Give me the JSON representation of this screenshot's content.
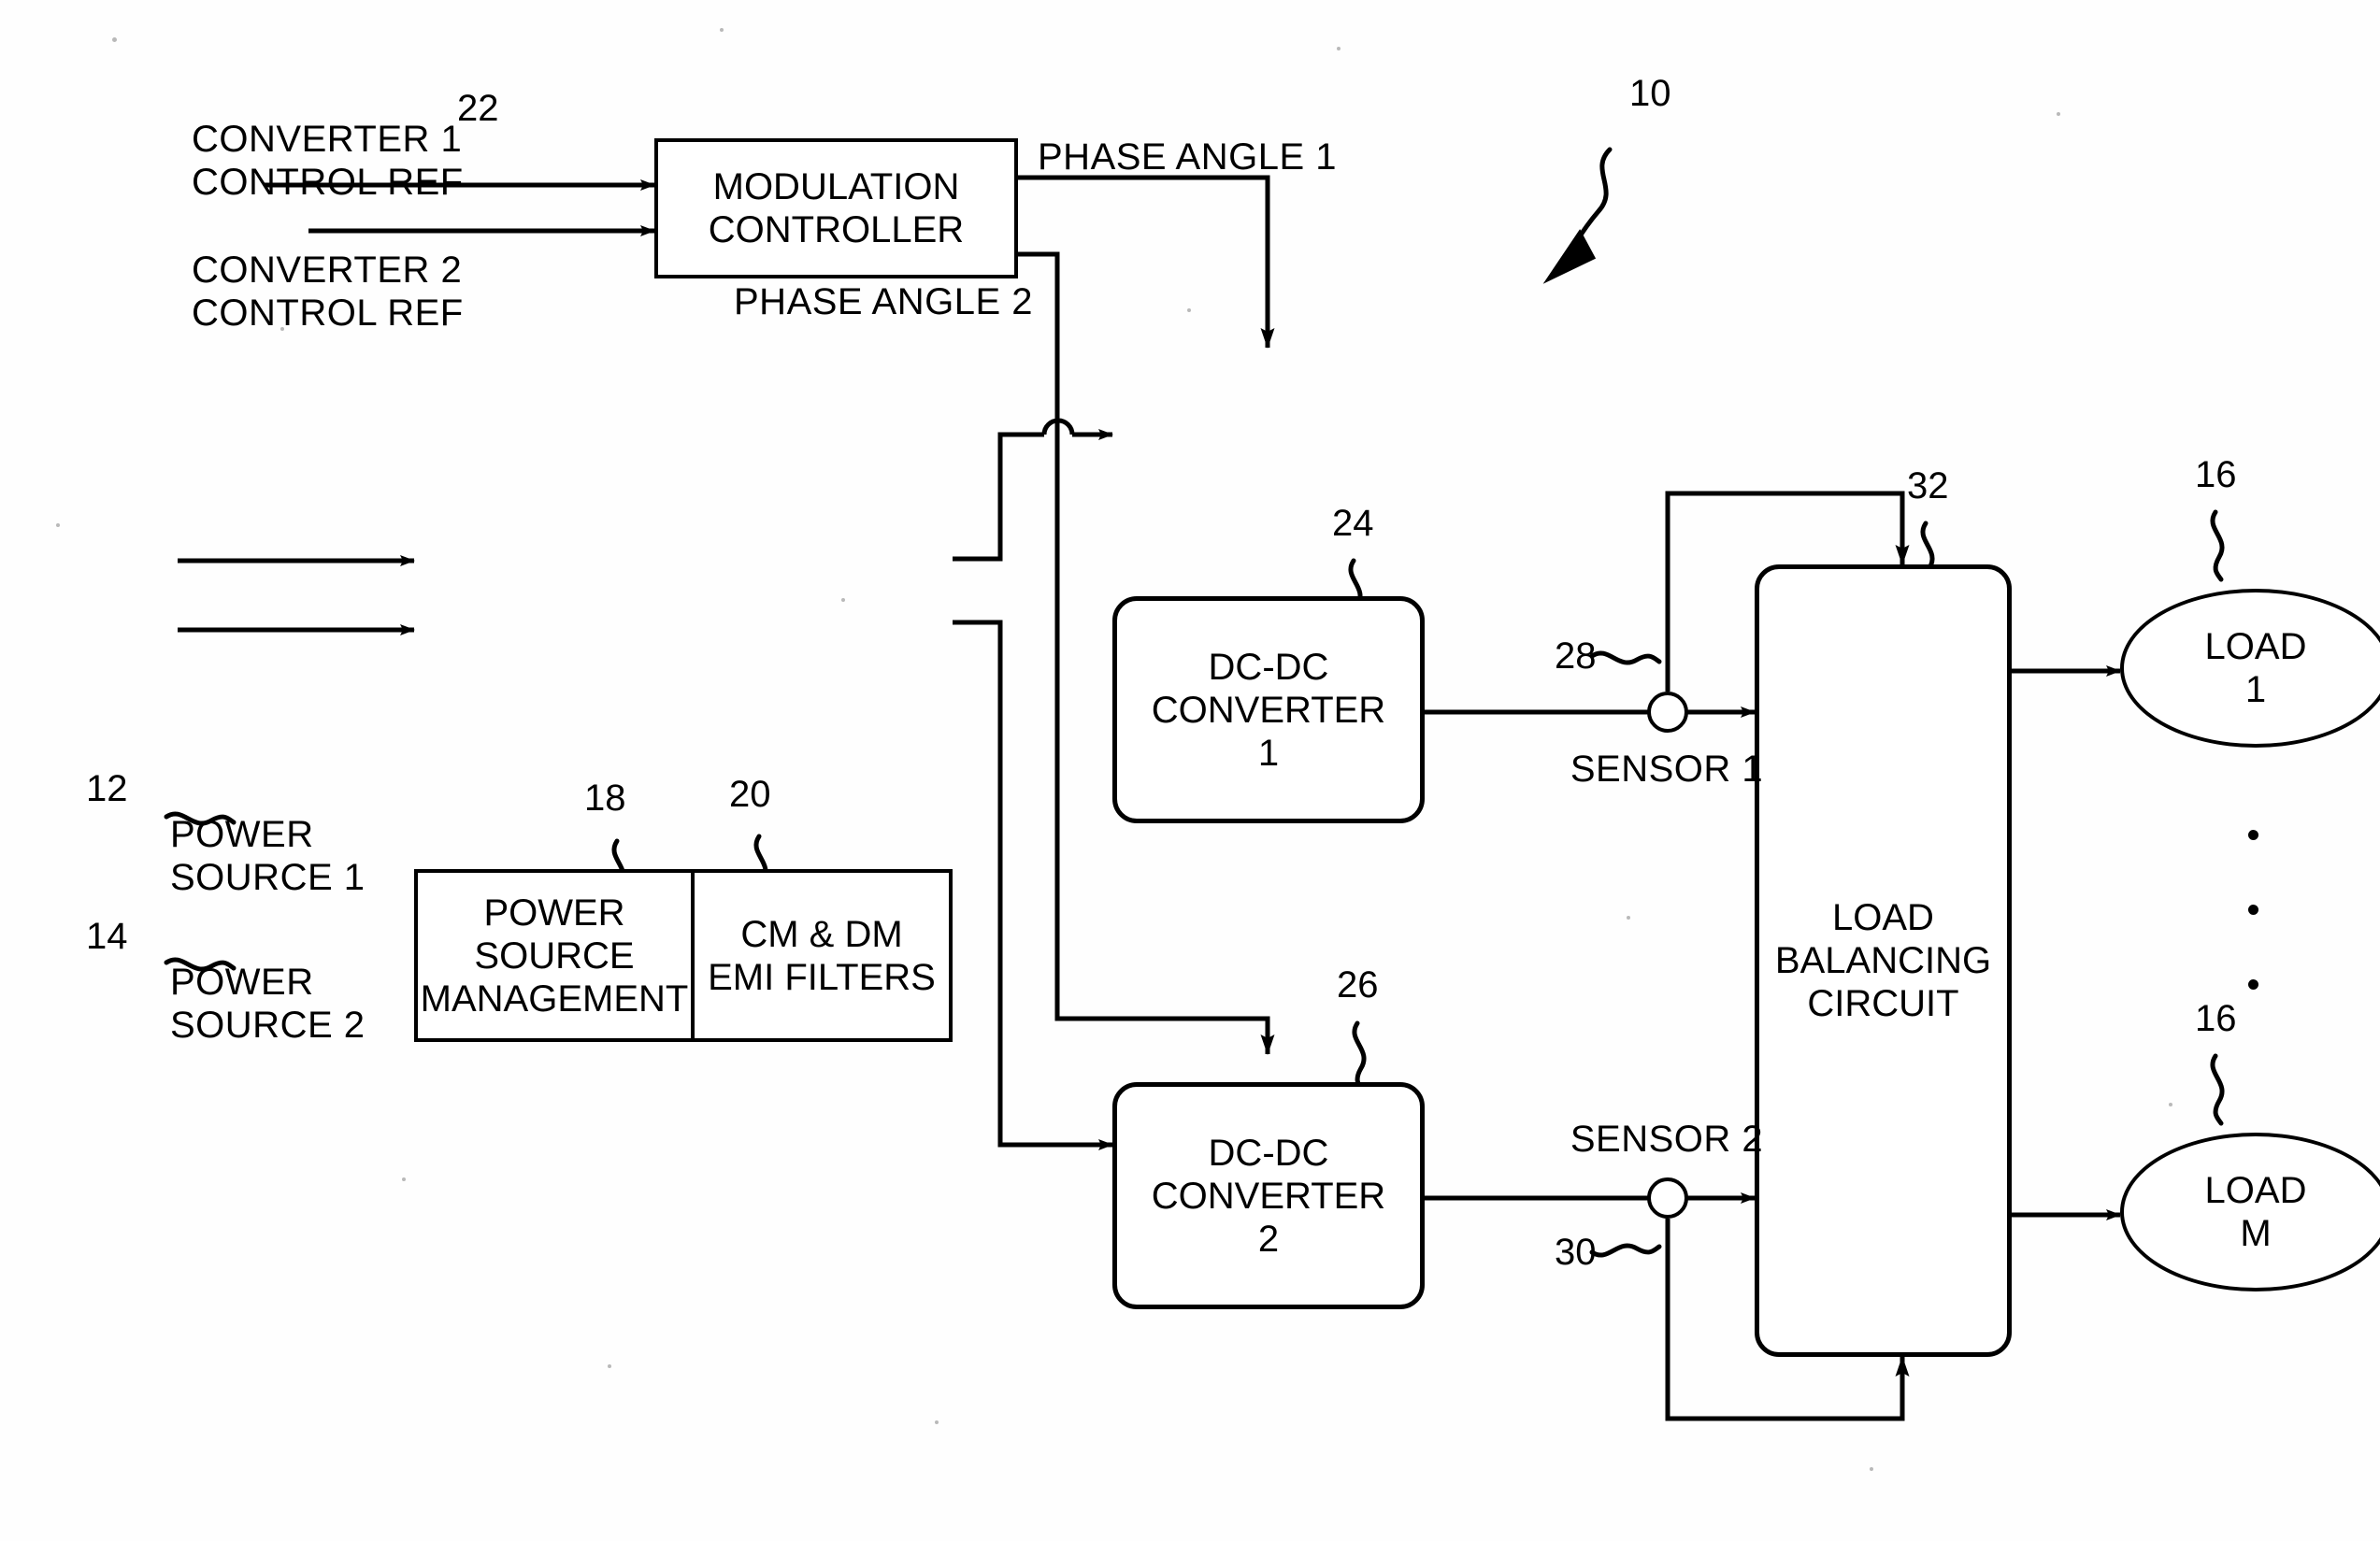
{
  "figure": {
    "type": "patent-block-diagram",
    "system_ref": "10",
    "inputs": {
      "converter1_control_ref": "CONVERTER 1\nCONTROL REF",
      "converter2_control_ref": "CONVERTER 2\nCONTROL REF",
      "power_source_1": "POWER\nSOURCE 1",
      "power_source_2": "POWER\nSOURCE 2",
      "power_source_1_ref": "12",
      "power_source_2_ref": "14"
    },
    "blocks": [
      {
        "id": "modulation_controller",
        "label": "MODULATION\nCONTROLLER",
        "ref": "22",
        "shape": "rect"
      },
      {
        "id": "power_source_management",
        "label": "POWER\nSOURCE\nMANAGEMENT",
        "ref": "18",
        "shape": "rect"
      },
      {
        "id": "emi_filters",
        "label": "CM & DM\nEMI FILTERS",
        "ref": "20",
        "shape": "rect"
      },
      {
        "id": "dc_dc_converter_1",
        "label": "DC-DC\nCONVERTER\n1",
        "ref": "24",
        "shape": "rounded-rect"
      },
      {
        "id": "dc_dc_converter_2",
        "label": "DC-DC\nCONVERTER\n2",
        "ref": "26",
        "shape": "rounded-rect"
      },
      {
        "id": "load_balancing_circuit",
        "label": "LOAD\nBALANCING\nCIRCUIT",
        "ref": "32",
        "shape": "rounded-rect"
      },
      {
        "id": "load_1",
        "label": "LOAD\n1",
        "ref": "16",
        "shape": "ellipse"
      },
      {
        "id": "load_m",
        "label": "LOAD\nM",
        "ref": "16",
        "shape": "ellipse"
      }
    ],
    "signals": {
      "phase_angle_1": "PHASE ANGLE 1",
      "phase_angle_2": "PHASE ANGLE 2"
    },
    "sensors": [
      {
        "id": "sensor_1",
        "label": "SENSOR 1",
        "ref": "28"
      },
      {
        "id": "sensor_2",
        "label": "SENSOR 2",
        "ref": "30"
      }
    ],
    "ellipsis": "⋮"
  }
}
